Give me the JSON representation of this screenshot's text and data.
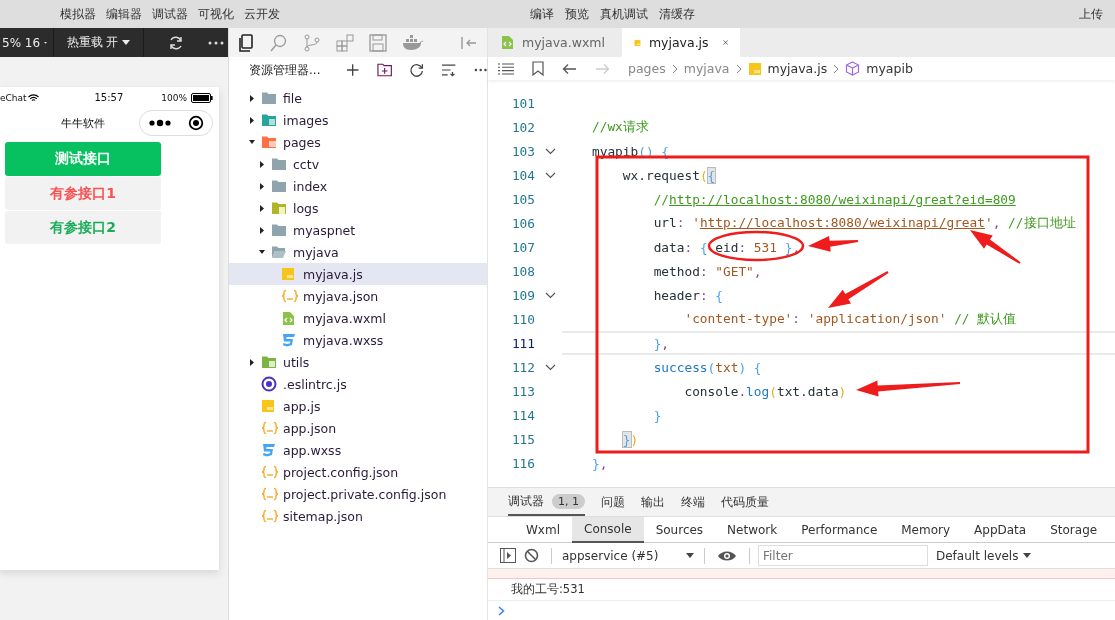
{
  "menu_bar": {
    "left_items": [
      "模拟器",
      "编辑器",
      "调试器",
      "可视化",
      "云开发"
    ],
    "center_items": [
      "编译",
      "预览",
      "真机调试",
      "清缓存"
    ],
    "right_items": [
      "上传"
    ]
  },
  "simulator": {
    "toolbar": {
      "zoom": "5% 16",
      "hot_reload": "热重载 开"
    },
    "status_bar": {
      "carrier": "eChat",
      "time": "15:57",
      "battery": "100%"
    },
    "nav_title": "牛牛软件",
    "buttons": [
      {
        "label": "测试接口",
        "kind": "primary"
      },
      {
        "label": "有参接口1",
        "kind": "warn"
      },
      {
        "label": "有参接口2",
        "kind": "success"
      }
    ]
  },
  "explorer": {
    "title": "资源管理器...",
    "tree": [
      {
        "label": "file",
        "kind": "folder",
        "expanded": false,
        "selected": false
      },
      {
        "label": "images",
        "kind": "folder-images",
        "expanded": false,
        "selected": false
      },
      {
        "label": "pages",
        "kind": "folder-pages",
        "expanded": true,
        "selected": false,
        "children": [
          {
            "label": "cctv",
            "kind": "folder",
            "expanded": false,
            "selected": false
          },
          {
            "label": "index",
            "kind": "folder",
            "expanded": false,
            "selected": false
          },
          {
            "label": "logs",
            "kind": "folder-logs",
            "expanded": false,
            "selected": false
          },
          {
            "label": "myaspnet",
            "kind": "folder",
            "expanded": false,
            "selected": false
          },
          {
            "label": "myjava",
            "kind": "folder",
            "expanded": true,
            "selected": false,
            "children": [
              {
                "label": "myjava.js",
                "kind": "js",
                "selected": true
              },
              {
                "label": "myjava.json",
                "kind": "json",
                "selected": false
              },
              {
                "label": "myjava.wxml",
                "kind": "wxml",
                "selected": false
              },
              {
                "label": "myjava.wxss",
                "kind": "wxss",
                "selected": false
              }
            ]
          }
        ]
      },
      {
        "label": "utils",
        "kind": "folder-utils",
        "expanded": false,
        "selected": false
      },
      {
        "label": ".eslintrc.js",
        "kind": "eslint",
        "selected": false
      },
      {
        "label": "app.js",
        "kind": "js",
        "selected": false
      },
      {
        "label": "app.json",
        "kind": "json",
        "selected": false
      },
      {
        "label": "app.wxss",
        "kind": "wxss",
        "selected": false
      },
      {
        "label": "project.config.json",
        "kind": "json",
        "selected": false
      },
      {
        "label": "project.private.config.json",
        "kind": "json",
        "selected": false
      },
      {
        "label": "sitemap.json",
        "kind": "json",
        "selected": false
      }
    ]
  },
  "editor": {
    "tabs": [
      {
        "label": "myjava.wxml",
        "kind": "wxml",
        "selected": false
      },
      {
        "label": "myjava.js",
        "kind": "js",
        "selected": true
      }
    ],
    "breadcrumb": [
      {
        "label": "pages",
        "kind": "folder"
      },
      {
        "label": "myjava",
        "kind": "folder"
      },
      {
        "label": "myjava.js",
        "kind": "js"
      },
      {
        "label": "myapib",
        "kind": "method"
      }
    ],
    "lines": [
      {
        "number": "101",
        "fold": false,
        "current": false
      },
      {
        "number": "102",
        "fold": false,
        "current": false,
        "tokens": [
          {
            "text": "//wx请求",
            "kind": "comment"
          }
        ]
      },
      {
        "number": "103",
        "fold": true,
        "current": false,
        "tokens": [
          {
            "text": "myapib",
            "kind": "plain"
          },
          {
            "text": "() {",
            "kind": "brace"
          }
        ]
      },
      {
        "number": "104",
        "fold": true,
        "current": false,
        "tokens": [
          {
            "text": "    wx.request",
            "kind": "plain"
          },
          {
            "text": "(",
            "kind": "paren"
          },
          {
            "text": "{",
            "kind": "brace-hl"
          }
        ]
      },
      {
        "number": "105",
        "fold": false,
        "current": false,
        "tokens": [
          {
            "text": "        //",
            "kind": "comment"
          },
          {
            "text": "http://localhost:8080/weixinapi/great?eid=809",
            "kind": "link-comment"
          }
        ]
      },
      {
        "number": "106",
        "fold": false,
        "current": false,
        "tokens": [
          {
            "text": "        url",
            "kind": "plain"
          },
          {
            "text": ": ",
            "kind": "punct"
          },
          {
            "text": "'",
            "kind": "string"
          },
          {
            "text": "http://localhost:8080/weixinapi/great",
            "kind": "link-string"
          },
          {
            "text": "'",
            "kind": "string"
          },
          {
            "text": ", ",
            "kind": "punct"
          },
          {
            "text": "//接口地址",
            "kind": "comment"
          }
        ]
      },
      {
        "number": "107",
        "fold": false,
        "current": false,
        "tokens": [
          {
            "text": "        data",
            "kind": "plain"
          },
          {
            "text": ":",
            "kind": "punct"
          },
          {
            "text": " { ",
            "kind": "brace"
          },
          {
            "text": "eid",
            "kind": "plain"
          },
          {
            "text": ": ",
            "kind": "punct"
          },
          {
            "text": "531",
            "kind": "number"
          },
          {
            "text": " }",
            "kind": "brace"
          },
          {
            "text": ",",
            "kind": "punct"
          }
        ]
      },
      {
        "number": "108",
        "fold": false,
        "current": false,
        "tokens": [
          {
            "text": "        method",
            "kind": "plain"
          },
          {
            "text": ": ",
            "kind": "punct"
          },
          {
            "text": "\"GET\"",
            "kind": "string"
          },
          {
            "text": ",",
            "kind": "punct"
          }
        ]
      },
      {
        "number": "109",
        "fold": true,
        "current": false,
        "tokens": [
          {
            "text": "        header",
            "kind": "plain"
          },
          {
            "text": ": ",
            "kind": "punct"
          },
          {
            "text": "{",
            "kind": "brace"
          }
        ]
      },
      {
        "number": "110",
        "fold": false,
        "current": false,
        "tokens": [
          {
            "text": "            'content-type'",
            "kind": "string"
          },
          {
            "text": ": ",
            "kind": "punct"
          },
          {
            "text": "'application/json'",
            "kind": "string"
          },
          {
            "text": " // 默认值",
            "kind": "comment"
          }
        ]
      },
      {
        "number": "111",
        "fold": false,
        "current": true,
        "tokens": [
          {
            "text": "        }",
            "kind": "brace"
          },
          {
            "text": ",",
            "kind": "punct"
          }
        ]
      },
      {
        "number": "112",
        "fold": true,
        "current": false,
        "tokens": [
          {
            "text": "        success",
            "kind": "fn"
          },
          {
            "text": "(",
            "kind": "brace"
          },
          {
            "text": "txt",
            "kind": "string"
          },
          {
            "text": ") {",
            "kind": "brace"
          }
        ]
      },
      {
        "number": "113",
        "fold": false,
        "current": false,
        "tokens": [
          {
            "text": "            console",
            "kind": "plain"
          },
          {
            "text": ".",
            "kind": "punct"
          },
          {
            "text": "log",
            "kind": "fn"
          },
          {
            "text": "(",
            "kind": "paren"
          },
          {
            "text": "txt.data",
            "kind": "plain"
          },
          {
            "text": ")",
            "kind": "paren"
          }
        ]
      },
      {
        "number": "114",
        "fold": false,
        "current": false,
        "tokens": [
          {
            "text": "        }",
            "kind": "brace"
          }
        ]
      },
      {
        "number": "115",
        "fold": false,
        "current": false,
        "tokens": [
          {
            "text": "    }",
            "kind": "brace-hl"
          },
          {
            "text": ")",
            "kind": "paren"
          }
        ]
      },
      {
        "number": "116",
        "fold": false,
        "current": false,
        "tokens": [
          {
            "text": "}",
            "kind": "brace"
          },
          {
            "text": ",",
            "kind": "punct"
          }
        ]
      }
    ],
    "annotations": [
      {
        "kind": "rectangle"
      },
      {
        "kind": "ellipse"
      },
      {
        "kind": "arrow"
      },
      {
        "kind": "arrow"
      },
      {
        "kind": "arrow"
      },
      {
        "kind": "arrow"
      }
    ]
  },
  "bottom_panel": {
    "tabs": [
      {
        "label": "调试器",
        "badge": "1, 1",
        "selected": true
      },
      {
        "label": "问题",
        "selected": false
      },
      {
        "label": "输出",
        "selected": false
      },
      {
        "label": "终端",
        "selected": false
      },
      {
        "label": "代码质量",
        "selected": false
      }
    ],
    "devtools_tabs": [
      {
        "label": "Wxml",
        "selected": false
      },
      {
        "label": "Console",
        "selected": true
      },
      {
        "label": "Sources",
        "selected": false
      },
      {
        "label": "Network",
        "selected": false
      },
      {
        "label": "Performance",
        "selected": false
      },
      {
        "label": "Memory",
        "selected": false
      },
      {
        "label": "AppData",
        "selected": false
      },
      {
        "label": "Storage",
        "selected": false
      }
    ],
    "context": "appservice (#5)",
    "filter_placeholder": "Filter",
    "levels": "Default levels",
    "log": [
      {
        "kind": "error"
      },
      {
        "kind": "log",
        "text": "我的工号:531"
      }
    ]
  }
}
